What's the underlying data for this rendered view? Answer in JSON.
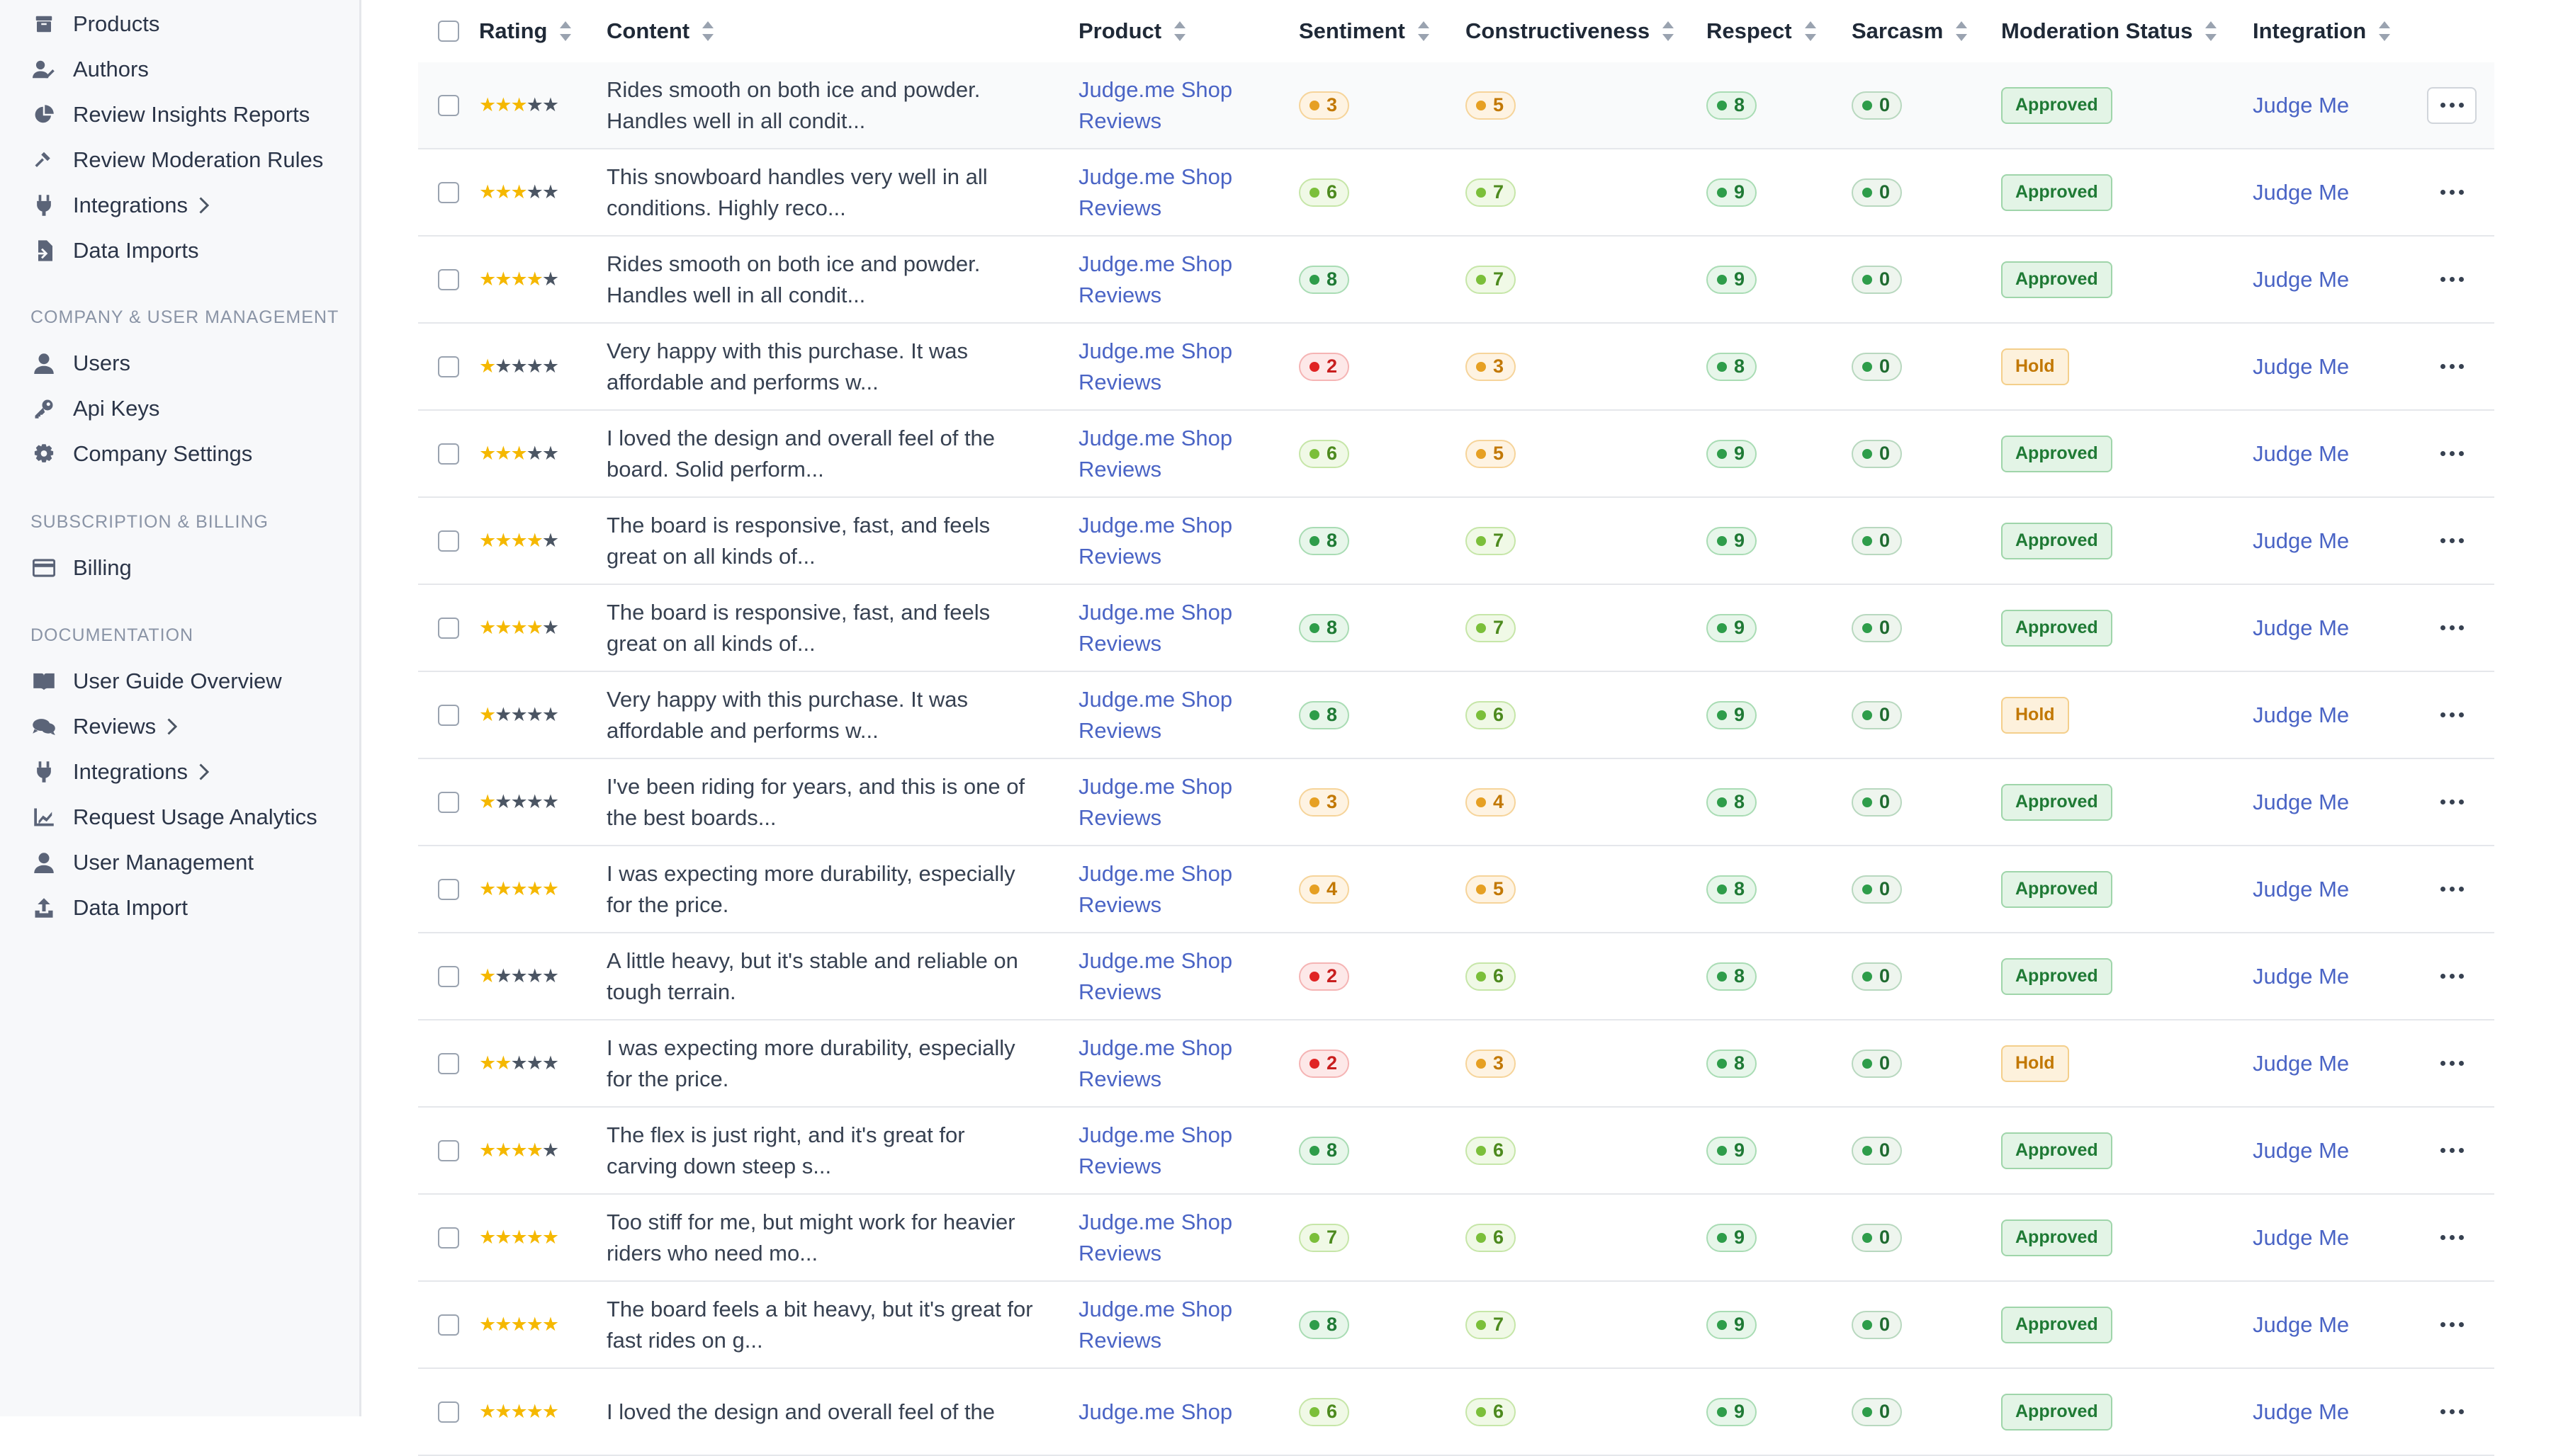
{
  "sidebar": {
    "group1": [
      {
        "label": "Products",
        "icon": "products-icon"
      },
      {
        "label": "Authors",
        "icon": "authors-icon"
      },
      {
        "label": "Review Insights Reports",
        "icon": "pie-chart-icon"
      },
      {
        "label": "Review Moderation Rules",
        "icon": "hammer-icon"
      },
      {
        "label": "Integrations",
        "icon": "plug-icon",
        "chevron": true
      },
      {
        "label": "Data Imports",
        "icon": "file-import-icon"
      }
    ],
    "section_company": "COMPANY & USER MANAGEMENT",
    "group2": [
      {
        "label": "Users",
        "icon": "user-icon"
      },
      {
        "label": "Api Keys",
        "icon": "key-icon"
      },
      {
        "label": "Company Settings",
        "icon": "gear-icon"
      }
    ],
    "section_billing": "SUBSCRIPTION & BILLING",
    "group3": [
      {
        "label": "Billing",
        "icon": "credit-card-icon"
      }
    ],
    "section_docs": "DOCUMENTATION",
    "group4": [
      {
        "label": "User Guide Overview",
        "icon": "book-icon"
      },
      {
        "label": "Reviews",
        "icon": "comments-icon",
        "chevron": true
      },
      {
        "label": "Integrations",
        "icon": "plug-icon",
        "chevron": true
      },
      {
        "label": "Request Usage Analytics",
        "icon": "bar-chart-icon"
      },
      {
        "label": "User Management",
        "icon": "user-icon"
      },
      {
        "label": "Data Import",
        "icon": "upload-icon"
      }
    ]
  },
  "table": {
    "headers": {
      "rating": "Rating",
      "content": "Content",
      "product": "Product",
      "sentiment": "Sentiment",
      "constructiveness": "Constructiveness",
      "respect": "Respect",
      "sarcasm": "Sarcasm",
      "moderation_status": "Moderation Status",
      "integration": "Integration"
    },
    "rows": [
      {
        "stars": 3,
        "content": [
          "Rides smooth on both ice and powder.",
          "Handles well in all condit..."
        ],
        "product": [
          "Judge.me Shop",
          "Reviews"
        ],
        "sentiment": "3",
        "constructiveness": "5",
        "respect": "8",
        "sarcasm": "0",
        "status": "Approved",
        "integration": "Judge Me"
      },
      {
        "stars": 3,
        "content": [
          "This snowboard handles very well in all",
          "conditions. Highly reco..."
        ],
        "product": [
          "Judge.me Shop",
          "Reviews"
        ],
        "sentiment": "6",
        "constructiveness": "7",
        "respect": "9",
        "sarcasm": "0",
        "status": "Approved",
        "integration": "Judge Me"
      },
      {
        "stars": 4,
        "content": [
          "Rides smooth on both ice and powder.",
          "Handles well in all condit..."
        ],
        "product": [
          "Judge.me Shop",
          "Reviews"
        ],
        "sentiment": "8",
        "constructiveness": "7",
        "respect": "9",
        "sarcasm": "0",
        "status": "Approved",
        "integration": "Judge Me"
      },
      {
        "stars": 1,
        "content": [
          "Very happy with this purchase. It was",
          "affordable and performs w..."
        ],
        "product": [
          "Judge.me Shop",
          "Reviews"
        ],
        "sentiment": "2",
        "constructiveness": "3",
        "respect": "8",
        "sarcasm": "0",
        "status": "Hold",
        "integration": "Judge Me"
      },
      {
        "stars": 3,
        "content": [
          "I loved the design and overall feel of the",
          "board. Solid perform..."
        ],
        "product": [
          "Judge.me Shop",
          "Reviews"
        ],
        "sentiment": "6",
        "constructiveness": "5",
        "respect": "9",
        "sarcasm": "0",
        "status": "Approved",
        "integration": "Judge Me"
      },
      {
        "stars": 4,
        "content": [
          "The board is responsive, fast, and feels",
          "great on all kinds of..."
        ],
        "product": [
          "Judge.me Shop",
          "Reviews"
        ],
        "sentiment": "8",
        "constructiveness": "7",
        "respect": "9",
        "sarcasm": "0",
        "status": "Approved",
        "integration": "Judge Me"
      },
      {
        "stars": 4,
        "content": [
          "The board is responsive, fast, and feels",
          "great on all kinds of..."
        ],
        "product": [
          "Judge.me Shop",
          "Reviews"
        ],
        "sentiment": "8",
        "constructiveness": "7",
        "respect": "9",
        "sarcasm": "0",
        "status": "Approved",
        "integration": "Judge Me"
      },
      {
        "stars": 1,
        "content": [
          "Very happy with this purchase. It was",
          "affordable and performs w..."
        ],
        "product": [
          "Judge.me Shop",
          "Reviews"
        ],
        "sentiment": "8",
        "constructiveness": "6",
        "respect": "9",
        "sarcasm": "0",
        "status": "Hold",
        "integration": "Judge Me"
      },
      {
        "stars": 1,
        "content": [
          "I've been riding for years, and this is one of",
          "the best boards..."
        ],
        "product": [
          "Judge.me Shop",
          "Reviews"
        ],
        "sentiment": "3",
        "constructiveness": "4",
        "respect": "8",
        "sarcasm": "0",
        "status": "Approved",
        "integration": "Judge Me"
      },
      {
        "stars": 5,
        "content": [
          "I was expecting more durability, especially",
          "for the price."
        ],
        "product": [
          "Judge.me Shop",
          "Reviews"
        ],
        "sentiment": "4",
        "constructiveness": "5",
        "respect": "8",
        "sarcasm": "0",
        "status": "Approved",
        "integration": "Judge Me"
      },
      {
        "stars": 1,
        "content": [
          "A little heavy, but it's stable and reliable on",
          "tough terrain."
        ],
        "product": [
          "Judge.me Shop",
          "Reviews"
        ],
        "sentiment": "2",
        "constructiveness": "6",
        "respect": "8",
        "sarcasm": "0",
        "status": "Approved",
        "integration": "Judge Me"
      },
      {
        "stars": 2,
        "content": [
          "I was expecting more durability, especially",
          "for the price."
        ],
        "product": [
          "Judge.me Shop",
          "Reviews"
        ],
        "sentiment": "2",
        "constructiveness": "3",
        "respect": "8",
        "sarcasm": "0",
        "status": "Hold",
        "integration": "Judge Me"
      },
      {
        "stars": 4,
        "content": [
          "The flex is just right, and it's great for",
          "carving down steep s..."
        ],
        "product": [
          "Judge.me Shop",
          "Reviews"
        ],
        "sentiment": "8",
        "constructiveness": "6",
        "respect": "9",
        "sarcasm": "0",
        "status": "Approved",
        "integration": "Judge Me"
      },
      {
        "stars": 5,
        "content": [
          "Too stiff for me, but might work for heavier",
          "riders who need mo..."
        ],
        "product": [
          "Judge.me Shop",
          "Reviews"
        ],
        "sentiment": "7",
        "constructiveness": "6",
        "respect": "9",
        "sarcasm": "0",
        "status": "Approved",
        "integration": "Judge Me"
      },
      {
        "stars": 5,
        "content": [
          "The board feels a bit heavy, but it's great for",
          "fast rides on g..."
        ],
        "product": [
          "Judge.me Shop",
          "Reviews"
        ],
        "sentiment": "8",
        "constructiveness": "7",
        "respect": "9",
        "sarcasm": "0",
        "status": "Approved",
        "integration": "Judge Me"
      },
      {
        "stars": 5,
        "content": [
          "I loved the design and overall feel of the",
          ""
        ],
        "product": [
          "Judge.me Shop",
          ""
        ],
        "sentiment": "6",
        "constructiveness": "6",
        "respect": "9",
        "sarcasm": "0",
        "status": "Approved",
        "integration": "Judge Me"
      }
    ]
  },
  "colors": {
    "star_on": "#f5b800",
    "star_off": "#4b5563",
    "link": "#4a64c5",
    "approved": "#1f7a35",
    "hold": "#c27803"
  }
}
